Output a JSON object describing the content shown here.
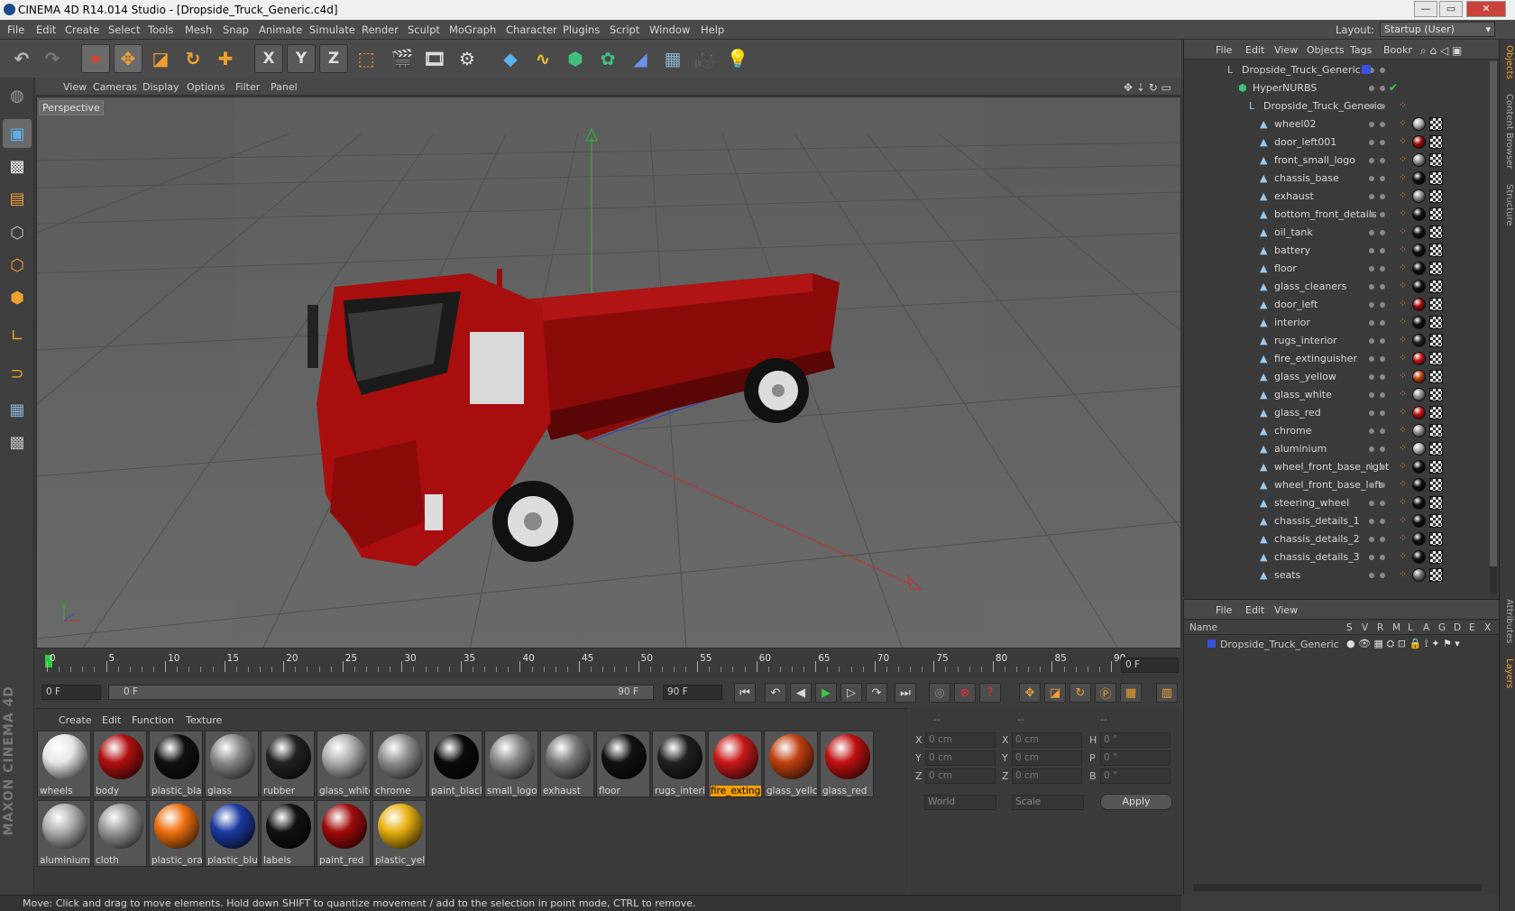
{
  "window": {
    "title": "CINEMA 4D R14.014 Studio - [Dropside_Truck_Generic.c4d]",
    "min": "—",
    "max": "▭",
    "close": "✕"
  },
  "menu": [
    "File",
    "Edit",
    "Create",
    "Select",
    "Tools",
    "Mesh",
    "Snap",
    "Animate",
    "Simulate",
    "Render",
    "Sculpt",
    "MoGraph",
    "Character",
    "Plugins",
    "Script",
    "Window",
    "Help"
  ],
  "layout": {
    "label": "Layout:",
    "value": "Startup (User)"
  },
  "toolbar": {
    "x_label": "X",
    "y_label": "Y",
    "z_label": "Z"
  },
  "viewport_menu": [
    "View",
    "Cameras",
    "Display",
    "Options",
    "Filter",
    "Panel"
  ],
  "viewport_label": "Perspective",
  "timeline": {
    "ticks": [
      "0",
      "5",
      "10",
      "15",
      "20",
      "25",
      "30",
      "35",
      "40",
      "45",
      "50",
      "55",
      "60",
      "65",
      "70",
      "75",
      "80",
      "85",
      "90"
    ],
    "current": "0 F"
  },
  "playbar": {
    "start": "0 F",
    "range_start": "0 F",
    "range_end": "90 F",
    "end": "90 F"
  },
  "mat_menu": [
    "Create",
    "Edit",
    "Function",
    "Texture"
  ],
  "materials": [
    {
      "name": "wheels",
      "color": "#e8e8e8"
    },
    {
      "name": "body",
      "color": "#b01010"
    },
    {
      "name": "plastic_bla",
      "color": "#111111"
    },
    {
      "name": "glass",
      "color": "#8a8a8a"
    },
    {
      "name": "rubber",
      "color": "#222222"
    },
    {
      "name": "glass_white",
      "color": "#b0b0b0"
    },
    {
      "name": "chrome",
      "color": "#909090"
    },
    {
      "name": "paint_black",
      "color": "#0a0a0a"
    },
    {
      "name": "small_logo",
      "color": "#8a8a8a"
    },
    {
      "name": "exhaust",
      "color": "#7a7a7a"
    },
    {
      "name": "floor",
      "color": "#111111"
    },
    {
      "name": "rugs_interi",
      "color": "#202020"
    },
    {
      "name": "fire_exting",
      "color": "#c81818"
    },
    {
      "name": "glass_yellc",
      "color": "#c04010"
    },
    {
      "name": "glass_red",
      "color": "#c01010"
    },
    {
      "name": "aluminium",
      "color": "#b0b0b0"
    },
    {
      "name": "cloth",
      "color": "#9a9a9a"
    },
    {
      "name": "plastic_ora",
      "color": "#f07010"
    },
    {
      "name": "plastic_blu",
      "color": "#1a3aa0"
    },
    {
      "name": "labels",
      "color": "#111111"
    },
    {
      "name": "paint_red",
      "color": "#a00a0a"
    },
    {
      "name": "plastic_yell",
      "color": "#e8b010"
    }
  ],
  "coords": {
    "headers": [
      "--",
      "--",
      "--"
    ],
    "rows": [
      {
        "a": "X",
        "av": "0 cm",
        "b": "X",
        "bv": "0 cm",
        "c": "H",
        "cv": "0 °"
      },
      {
        "a": "Y",
        "av": "0 cm",
        "b": "Y",
        "bv": "0 cm",
        "c": "P",
        "cv": "0 °"
      },
      {
        "a": "Z",
        "av": "0 cm",
        "b": "Z",
        "bv": "0 cm",
        "c": "B",
        "cv": "0 °"
      }
    ],
    "world": "World",
    "scale": "Scale",
    "apply": "Apply"
  },
  "status": "Move: Click and drag to move elements. Hold down SHIFT to quantize movement / add to the selection in point mode, CTRL to remove.",
  "obj_menu": [
    "File",
    "Edit",
    "View",
    "Objects",
    "Tags",
    "Bookr"
  ],
  "objects": [
    {
      "name": "Dropside_Truck_Generic",
      "indent": 0,
      "tag": ""
    },
    {
      "name": "HyperNURBS",
      "indent": 1,
      "tag": ""
    },
    {
      "name": "Dropside_Truck_Generic",
      "indent": 2,
      "tag": ""
    },
    {
      "name": "wheel02",
      "indent": 3,
      "tag": "#b0b0b0"
    },
    {
      "name": "door_left001",
      "indent": 3,
      "tag": "#a00a0a"
    },
    {
      "name": "front_small_logo",
      "indent": 3,
      "tag": "#909090"
    },
    {
      "name": "chassis_base",
      "indent": 3,
      "tag": "#111111"
    },
    {
      "name": "exhaust",
      "indent": 3,
      "tag": "#909090"
    },
    {
      "name": "bottom_front_details",
      "indent": 3,
      "tag": "#111111"
    },
    {
      "name": "oil_tank",
      "indent": 3,
      "tag": "#111111"
    },
    {
      "name": "battery",
      "indent": 3,
      "tag": "#111111"
    },
    {
      "name": "floor",
      "indent": 3,
      "tag": "#111111"
    },
    {
      "name": "glass_cleaners",
      "indent": 3,
      "tag": "#111111"
    },
    {
      "name": "door_left",
      "indent": 3,
      "tag": "#a00a0a"
    },
    {
      "name": "interior",
      "indent": 3,
      "tag": "#111111"
    },
    {
      "name": "rugs_interior",
      "indent": 3,
      "tag": "#222222"
    },
    {
      "name": "fire_extinguisher",
      "indent": 3,
      "tag": "#c81818"
    },
    {
      "name": "glass_yellow",
      "indent": 3,
      "tag": "#c04010"
    },
    {
      "name": "glass_white",
      "indent": 3,
      "tag": "#909090"
    },
    {
      "name": "glass_red",
      "indent": 3,
      "tag": "#c01010"
    },
    {
      "name": "chrome",
      "indent": 3,
      "tag": "#909090"
    },
    {
      "name": "aluminium",
      "indent": 3,
      "tag": "#b0b0b0"
    },
    {
      "name": "wheel_front_base_right",
      "indent": 3,
      "tag": "#111111"
    },
    {
      "name": "wheel_front_base_left",
      "indent": 3,
      "tag": "#111111"
    },
    {
      "name": "steering_wheel",
      "indent": 3,
      "tag": "#111111"
    },
    {
      "name": "chassis_details_1",
      "indent": 3,
      "tag": "#111111"
    },
    {
      "name": "chassis_details_2",
      "indent": 3,
      "tag": "#111111"
    },
    {
      "name": "chassis_details_3",
      "indent": 3,
      "tag": "#111111"
    },
    {
      "name": "seats",
      "indent": 3,
      "tag": "#707070"
    }
  ],
  "layer_menu": [
    "File",
    "Edit",
    "View"
  ],
  "layer_header": {
    "name": "Name",
    "cols": [
      "S",
      "V",
      "R",
      "M",
      "L",
      "A",
      "G",
      "D",
      "E",
      "X"
    ]
  },
  "layer_row": "Dropside_Truck_Generic",
  "side_tabs": [
    "Objects",
    "Content Browser",
    "Structure",
    "Attributes",
    "Layers"
  ],
  "brand": "MAXON CINEMA 4D"
}
